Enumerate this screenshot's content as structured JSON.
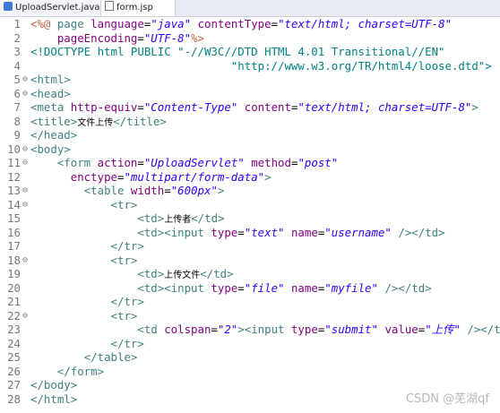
{
  "tabs": [
    {
      "label": "UploadServlet.java",
      "icon": "java-file-icon"
    },
    {
      "label": "form.jsp",
      "icon": "jsp-file-icon"
    }
  ],
  "lines": [
    {
      "n": "1",
      "fold": "",
      "t": [
        [
          "bm",
          "<%@ "
        ],
        [
          "tg",
          "page "
        ],
        [
          "an",
          "language"
        ],
        [
          "",
          "="
        ],
        [
          "av",
          "\"java\""
        ],
        [
          "",
          " "
        ],
        [
          "an",
          "contentType"
        ],
        [
          "",
          "="
        ],
        [
          "av",
          "\"text/html; charset=UTF-8\""
        ]
      ]
    },
    {
      "n": "2",
      "fold": "",
      "t": [
        [
          "",
          "    "
        ],
        [
          "an",
          "pageEncoding"
        ],
        [
          "",
          "="
        ],
        [
          "av",
          "\"UTF-8\""
        ],
        [
          "bm",
          "%>"
        ]
      ]
    },
    {
      "n": "3",
      "fold": "",
      "t": [
        [
          "dk",
          "<!DOCTYPE html PUBLIC \"-//W3C//DTD HTML 4.01 Transitional//EN\""
        ]
      ]
    },
    {
      "n": "4",
      "fold": "",
      "t": [
        [
          "dk",
          "                              \"http://www.w3.org/TR/html4/loose.dtd\">"
        ]
      ]
    },
    {
      "n": "5",
      "fold": "⊖",
      "t": [
        [
          "tg",
          "<html>"
        ]
      ]
    },
    {
      "n": "6",
      "fold": "⊖",
      "t": [
        [
          "tg",
          "<head>"
        ]
      ]
    },
    {
      "n": "7",
      "fold": "",
      "t": [
        [
          "tg",
          "<meta "
        ],
        [
          "an",
          "http-equiv"
        ],
        [
          "",
          "="
        ],
        [
          "av",
          "\"Content-Type\""
        ],
        [
          "",
          " "
        ],
        [
          "an",
          "content"
        ],
        [
          "",
          "="
        ],
        [
          "av",
          "\"text/html; charset=UTF-8\""
        ],
        [
          "tg",
          ">"
        ]
      ]
    },
    {
      "n": "8",
      "fold": "",
      "t": [
        [
          "tg",
          "<title>"
        ],
        [
          "cjk",
          "文件上传"
        ],
        [
          "tg",
          "</title>"
        ]
      ]
    },
    {
      "n": "9",
      "fold": "",
      "t": [
        [
          "tg",
          "</head>"
        ]
      ]
    },
    {
      "n": "10",
      "fold": "⊖",
      "t": [
        [
          "tg",
          "<body>"
        ]
      ]
    },
    {
      "n": "11",
      "fold": "⊖",
      "t": [
        [
          "",
          "    "
        ],
        [
          "tg",
          "<form "
        ],
        [
          "an",
          "action"
        ],
        [
          "",
          "="
        ],
        [
          "av",
          "\"UploadServlet\""
        ],
        [
          "",
          " "
        ],
        [
          "an",
          "method"
        ],
        [
          "",
          "="
        ],
        [
          "av",
          "\"post\""
        ]
      ]
    },
    {
      "n": "12",
      "fold": "",
      "t": [
        [
          "",
          "      "
        ],
        [
          "an",
          "enctype"
        ],
        [
          "",
          "="
        ],
        [
          "av",
          "\"multipart/form-data\""
        ],
        [
          "tg",
          ">"
        ]
      ]
    },
    {
      "n": "13",
      "fold": "⊖",
      "t": [
        [
          "",
          "        "
        ],
        [
          "tg",
          "<table "
        ],
        [
          "an",
          "width"
        ],
        [
          "",
          "="
        ],
        [
          "av",
          "\"600px\""
        ],
        [
          "tg",
          ">"
        ]
      ]
    },
    {
      "n": "14",
      "fold": "⊖",
      "t": [
        [
          "",
          "            "
        ],
        [
          "tg",
          "<tr>"
        ]
      ]
    },
    {
      "n": "15",
      "fold": "",
      "t": [
        [
          "",
          "                "
        ],
        [
          "tg",
          "<td>"
        ],
        [
          "cjk",
          "上传者"
        ],
        [
          "tg",
          "</td>"
        ]
      ]
    },
    {
      "n": "16",
      "fold": "",
      "t": [
        [
          "",
          "                "
        ],
        [
          "tg",
          "<td><input "
        ],
        [
          "an",
          "type"
        ],
        [
          "",
          "="
        ],
        [
          "av",
          "\"text\""
        ],
        [
          "",
          " "
        ],
        [
          "an",
          "name"
        ],
        [
          "",
          "="
        ],
        [
          "av",
          "\"username\""
        ],
        [
          "",
          " "
        ],
        [
          "tg",
          "/></td>"
        ]
      ]
    },
    {
      "n": "17",
      "fold": "",
      "t": [
        [
          "",
          "            "
        ],
        [
          "tg",
          "</tr>"
        ]
      ]
    },
    {
      "n": "18",
      "fold": "⊖",
      "t": [
        [
          "",
          "            "
        ],
        [
          "tg",
          "<tr>"
        ]
      ]
    },
    {
      "n": "19",
      "fold": "",
      "t": [
        [
          "",
          "                "
        ],
        [
          "tg",
          "<td>"
        ],
        [
          "cjk",
          "上传文件"
        ],
        [
          "tg",
          "</td>"
        ]
      ]
    },
    {
      "n": "20",
      "fold": "",
      "t": [
        [
          "",
          "                "
        ],
        [
          "tg",
          "<td><input "
        ],
        [
          "an",
          "type"
        ],
        [
          "",
          "="
        ],
        [
          "av",
          "\"file\""
        ],
        [
          "",
          " "
        ],
        [
          "an",
          "name"
        ],
        [
          "",
          "="
        ],
        [
          "av",
          "\"myfile\""
        ],
        [
          "",
          " "
        ],
        [
          "tg",
          "/></td>"
        ]
      ]
    },
    {
      "n": "21",
      "fold": "",
      "t": [
        [
          "",
          "            "
        ],
        [
          "tg",
          "</tr>"
        ]
      ]
    },
    {
      "n": "22",
      "fold": "⊖",
      "t": [
        [
          "",
          "            "
        ],
        [
          "tg",
          "<tr>"
        ]
      ]
    },
    {
      "n": "23",
      "fold": "",
      "t": [
        [
          "",
          "                "
        ],
        [
          "tg",
          "<td "
        ],
        [
          "an",
          "colspan"
        ],
        [
          "",
          "="
        ],
        [
          "av",
          "\"2\""
        ],
        [
          "tg",
          "><input "
        ],
        [
          "an",
          "type"
        ],
        [
          "",
          "="
        ],
        [
          "av",
          "\"submit\""
        ],
        [
          "",
          " "
        ],
        [
          "an",
          "value"
        ],
        [
          "",
          "="
        ],
        [
          "av",
          "\"上传\""
        ],
        [
          "",
          " "
        ],
        [
          "tg",
          "/></td>"
        ]
      ]
    },
    {
      "n": "24",
      "fold": "",
      "t": [
        [
          "",
          "            "
        ],
        [
          "tg",
          "</tr>"
        ]
      ]
    },
    {
      "n": "25",
      "fold": "",
      "t": [
        [
          "",
          "        "
        ],
        [
          "tg",
          "</table>"
        ]
      ]
    },
    {
      "n": "26",
      "fold": "",
      "t": [
        [
          "",
          "    "
        ],
        [
          "tg",
          "</form>"
        ]
      ]
    },
    {
      "n": "27",
      "fold": "",
      "t": [
        [
          "tg",
          "</body>"
        ]
      ]
    },
    {
      "n": "28",
      "fold": "",
      "t": [
        [
          "tg",
          "</html>"
        ]
      ]
    }
  ],
  "watermark": "CSDN @芜湖qf"
}
